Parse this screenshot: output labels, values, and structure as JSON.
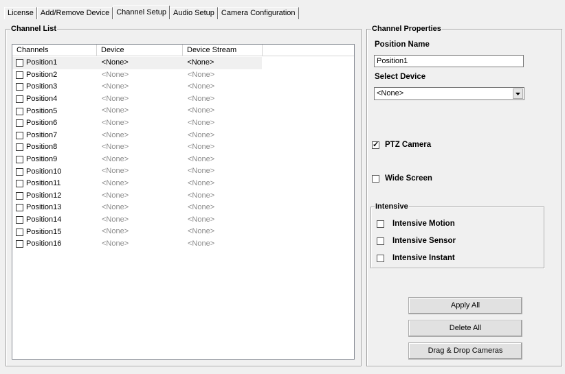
{
  "tabs": [
    {
      "label": "License",
      "active": false
    },
    {
      "label": "Add/Remove Device",
      "active": false
    },
    {
      "label": "Channel Setup",
      "active": true
    },
    {
      "label": "Audio Setup",
      "active": false
    },
    {
      "label": "Camera Configuration",
      "active": false
    }
  ],
  "channel_list": {
    "title": "Channel List",
    "columns": [
      "Channels",
      "Device",
      "Device Stream",
      ""
    ],
    "rows": [
      {
        "name": "Position1",
        "device": "<None>",
        "stream": "<None>",
        "checked": false,
        "selected": true
      },
      {
        "name": "Position2",
        "device": "<None>",
        "stream": "<None>",
        "checked": false,
        "selected": false
      },
      {
        "name": "Position3",
        "device": "<None>",
        "stream": "<None>",
        "checked": false,
        "selected": false
      },
      {
        "name": "Position4",
        "device": "<None>",
        "stream": "<None>",
        "checked": false,
        "selected": false
      },
      {
        "name": "Position5",
        "device": "<None>",
        "stream": "<None>",
        "checked": false,
        "selected": false
      },
      {
        "name": "Position6",
        "device": "<None>",
        "stream": "<None>",
        "checked": false,
        "selected": false
      },
      {
        "name": "Position7",
        "device": "<None>",
        "stream": "<None>",
        "checked": false,
        "selected": false
      },
      {
        "name": "Position8",
        "device": "<None>",
        "stream": "<None>",
        "checked": false,
        "selected": false
      },
      {
        "name": "Position9",
        "device": "<None>",
        "stream": "<None>",
        "checked": false,
        "selected": false
      },
      {
        "name": "Position10",
        "device": "<None>",
        "stream": "<None>",
        "checked": false,
        "selected": false
      },
      {
        "name": "Position11",
        "device": "<None>",
        "stream": "<None>",
        "checked": false,
        "selected": false
      },
      {
        "name": "Position12",
        "device": "<None>",
        "stream": "<None>",
        "checked": false,
        "selected": false
      },
      {
        "name": "Position13",
        "device": "<None>",
        "stream": "<None>",
        "checked": false,
        "selected": false
      },
      {
        "name": "Position14",
        "device": "<None>",
        "stream": "<None>",
        "checked": false,
        "selected": false
      },
      {
        "name": "Position15",
        "device": "<None>",
        "stream": "<None>",
        "checked": false,
        "selected": false
      },
      {
        "name": "Position16",
        "device": "<None>",
        "stream": "<None>",
        "checked": false,
        "selected": false
      }
    ]
  },
  "properties": {
    "title": "Channel Properties",
    "position_name_label": "Position Name",
    "position_name_value": "Position1",
    "select_device_label": "Select Device",
    "select_device_value": "<None>",
    "ptz_camera": {
      "label": "PTZ Camera",
      "checked": true
    },
    "wide_screen": {
      "label": "Wide Screen",
      "checked": false
    },
    "intensive": {
      "title": "Intensive",
      "motion": {
        "label": "Intensive Motion",
        "checked": false
      },
      "sensor": {
        "label": "Intensive Sensor",
        "checked": false
      },
      "instant": {
        "label": "Intensive Instant",
        "checked": false
      }
    }
  },
  "buttons": {
    "apply_all": "Apply All",
    "delete_all": "Delete All",
    "drag_drop": "Drag & Drop Cameras"
  }
}
